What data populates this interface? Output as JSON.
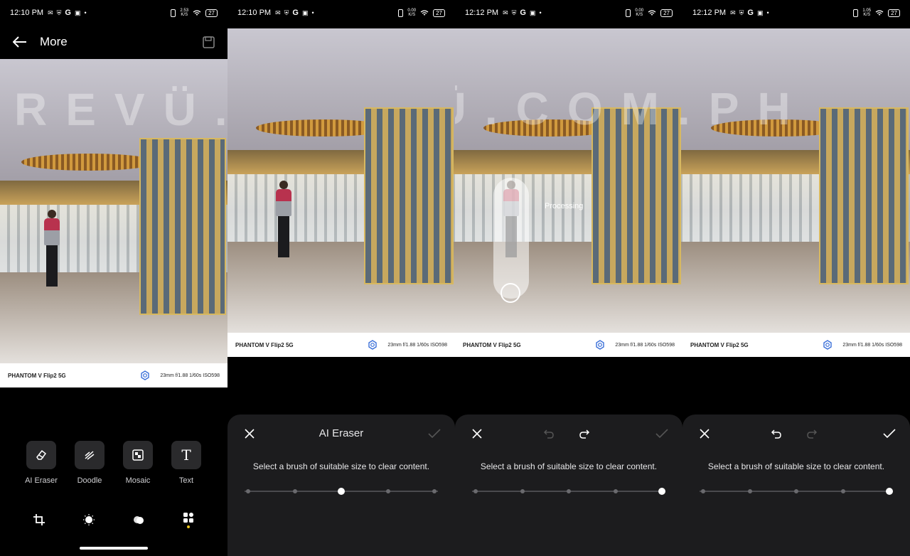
{
  "status_bars": [
    {
      "time": "12:10 PM",
      "speed": "2.53\nK/S",
      "battery": "27"
    },
    {
      "time": "12:10 PM",
      "speed": "0.00\nK/S",
      "battery": "27"
    },
    {
      "time": "12:12 PM",
      "speed": "0.00\nK/S",
      "battery": "27"
    },
    {
      "time": "12:12 PM",
      "speed": "1.05\nK/S",
      "battery": "27"
    }
  ],
  "header": {
    "title": "More"
  },
  "photo_caption": {
    "model": "PHANTOM V Flip2 5G",
    "exif": "23mm f/1.88 1/60s ISO598"
  },
  "watermark": "REVÜ.COM.PH",
  "processing_label": "Processing",
  "tools": [
    {
      "label": "AI Eraser",
      "icon": "eraser-icon"
    },
    {
      "label": "Doodle",
      "icon": "doodle-icon"
    },
    {
      "label": "Mosaic",
      "icon": "mosaic-icon"
    },
    {
      "label": "Text",
      "icon": "text-icon"
    }
  ],
  "bottom_nav": [
    {
      "icon": "crop-icon"
    },
    {
      "icon": "adjust-icon"
    },
    {
      "icon": "filter-icon"
    },
    {
      "icon": "more-tools-icon",
      "active": true
    }
  ],
  "eraser_sheet": {
    "title": "AI Eraser",
    "hint": "Select a brush of suitable size to clear content."
  },
  "brush_sizes": {
    "panel2_selected_index": 2,
    "panel3_selected_index": 4,
    "panel4_selected_index": 4,
    "count": 5
  },
  "colors": {
    "accent_dot": "#e8c21c",
    "sheet_bg": "#1c1c1e",
    "tool_bg": "#2a2a2c"
  }
}
